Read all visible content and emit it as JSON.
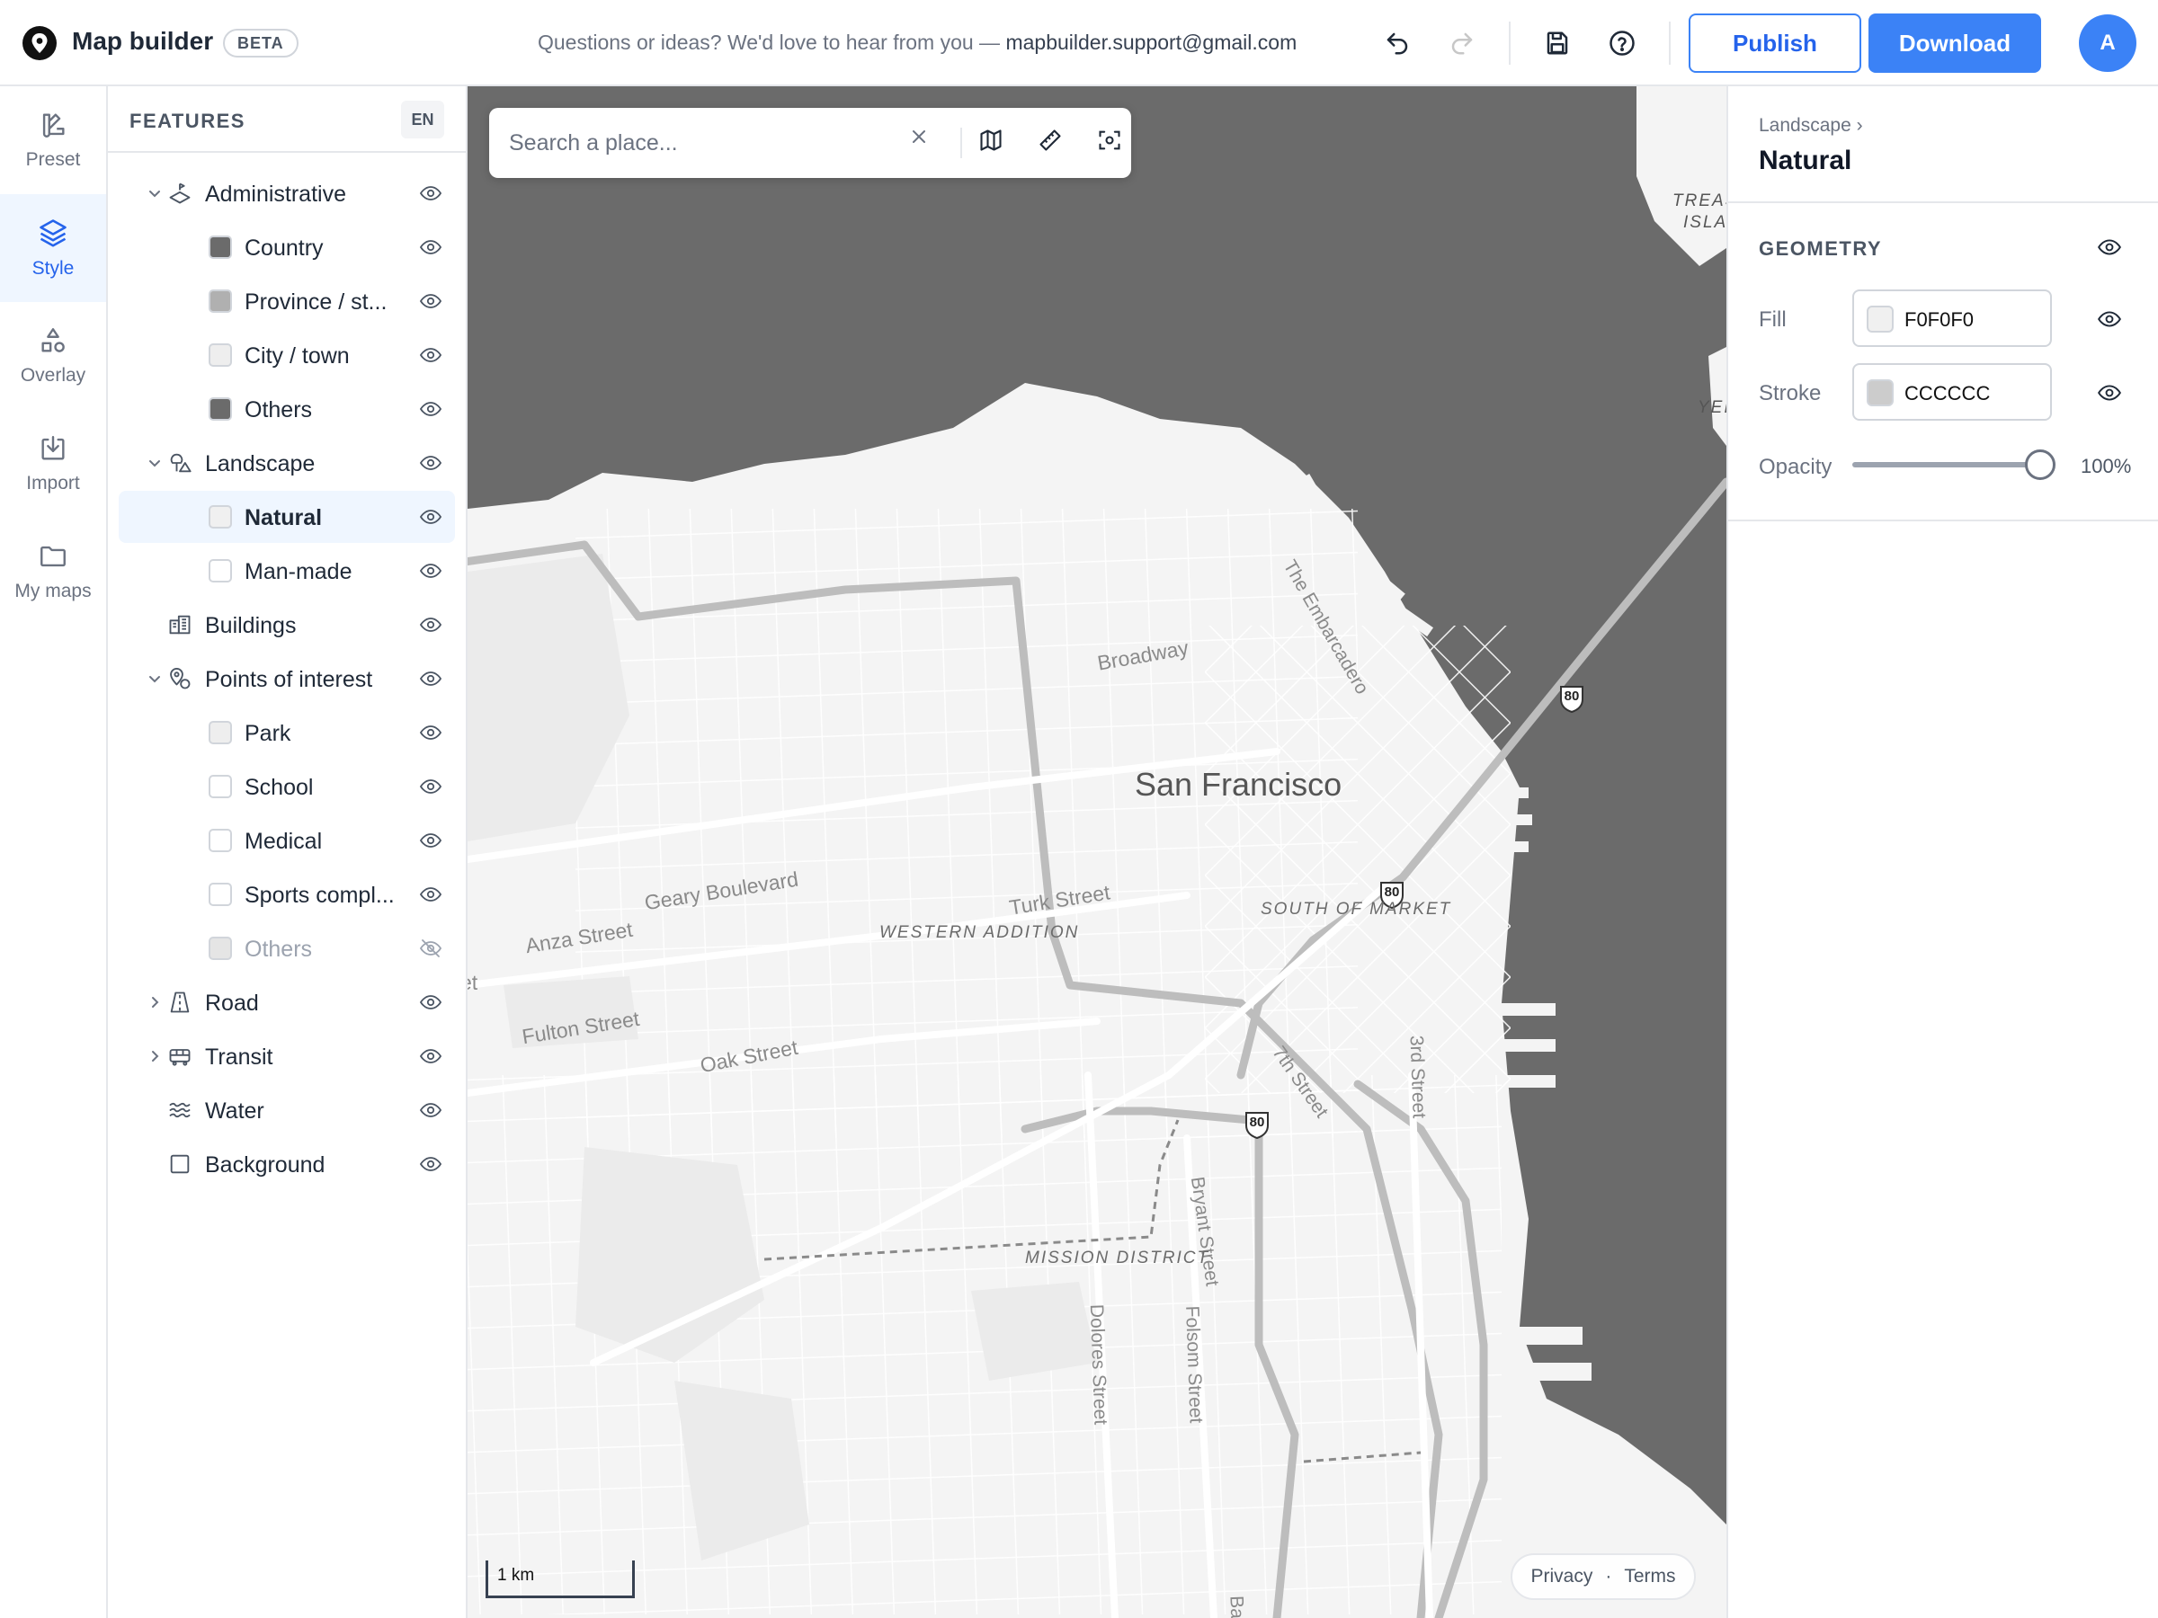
{
  "topbar": {
    "app_title": "Map builder",
    "beta_badge": "BETA",
    "feedback_text": "Questions or ideas? We'd love to hear from you — ",
    "feedback_email": "mapbuilder.support@gmail.com",
    "publish_label": "Publish",
    "download_label": "Download",
    "avatar_initial": "A"
  },
  "rail": {
    "items": [
      {
        "label": "Preset",
        "icon": "preset-icon"
      },
      {
        "label": "Style",
        "icon": "layers-icon",
        "active": true
      },
      {
        "label": "Overlay",
        "icon": "shapes-icon"
      },
      {
        "label": "Import",
        "icon": "import-icon"
      },
      {
        "label": "My maps",
        "icon": "folder-icon"
      }
    ]
  },
  "features": {
    "title": "FEATURES",
    "lang": "EN",
    "items": [
      {
        "label": "Administrative",
        "expanded": true
      },
      {
        "label": "Country",
        "swatch": "#6b6b6b"
      },
      {
        "label": "Province / st...",
        "swatch": "#b0b0b0"
      },
      {
        "label": "City / town",
        "swatch": "#eeeeee"
      },
      {
        "label": "Others",
        "swatch": "#6b6b6b"
      },
      {
        "label": "Landscape",
        "expanded": true
      },
      {
        "label": "Natural",
        "swatch": "#F0F0F0",
        "selected": true
      },
      {
        "label": "Man-made",
        "swatch": "#ffffff"
      },
      {
        "label": "Buildings"
      },
      {
        "label": "Points of interest",
        "expanded": true
      },
      {
        "label": "Park",
        "swatch": "#eeeeee"
      },
      {
        "label": "School",
        "swatch": "#ffffff"
      },
      {
        "label": "Medical",
        "swatch": "#ffffff"
      },
      {
        "label": "Sports compl...",
        "swatch": "#ffffff"
      },
      {
        "label": "Others",
        "swatch": "#e5e5e5",
        "hidden": true
      },
      {
        "label": "Road",
        "expanded": false
      },
      {
        "label": "Transit",
        "expanded": false
      },
      {
        "label": "Water"
      },
      {
        "label": "Background"
      }
    ]
  },
  "map": {
    "search_placeholder": "Search a place...",
    "scale_label": "1 km",
    "privacy": "Privacy",
    "dot": "·",
    "terms": "Terms",
    "city_label": "San Francisco",
    "street_labels": {
      "broadway": "Broadway",
      "geary": "Geary Boulevard",
      "anza": "Anza Street",
      "turk": "Turk Street",
      "fulton": "Fulton Street",
      "oak": "Oak Street",
      "embarcadero": "The Embarcadero",
      "seventh": "7th Street",
      "third": "3rd Street",
      "bryant": "Bryant Street",
      "dolores": "Dolores Street",
      "folsom": "Folsom Street",
      "edge_et": "et",
      "edge_ba": "Ba"
    },
    "districts": {
      "soma": "SOUTH OF MARKET",
      "western": "WESTERN ADDITION",
      "mission": "MISSION DISTRICT",
      "treasure_1": "TREAS",
      "treasure_2": "ISLA",
      "yerba": "YEI"
    },
    "shield_80": "80",
    "colors": {
      "water": "#6b6b6b",
      "land": "#f4f4f4",
      "road": "#ffffff",
      "highway": "#bdbdbd"
    }
  },
  "right_panel": {
    "breadcrumb": "Landscape ›",
    "title": "Natural",
    "section_title": "GEOMETRY",
    "fill_label": "Fill",
    "fill_value": "F0F0F0",
    "fill_color": "#F0F0F0",
    "stroke_label": "Stroke",
    "stroke_value": "CCCCCC",
    "stroke_color": "#CCCCCC",
    "opacity_label": "Opacity",
    "opacity_value": "100%",
    "opacity_fraction": 1.0
  }
}
